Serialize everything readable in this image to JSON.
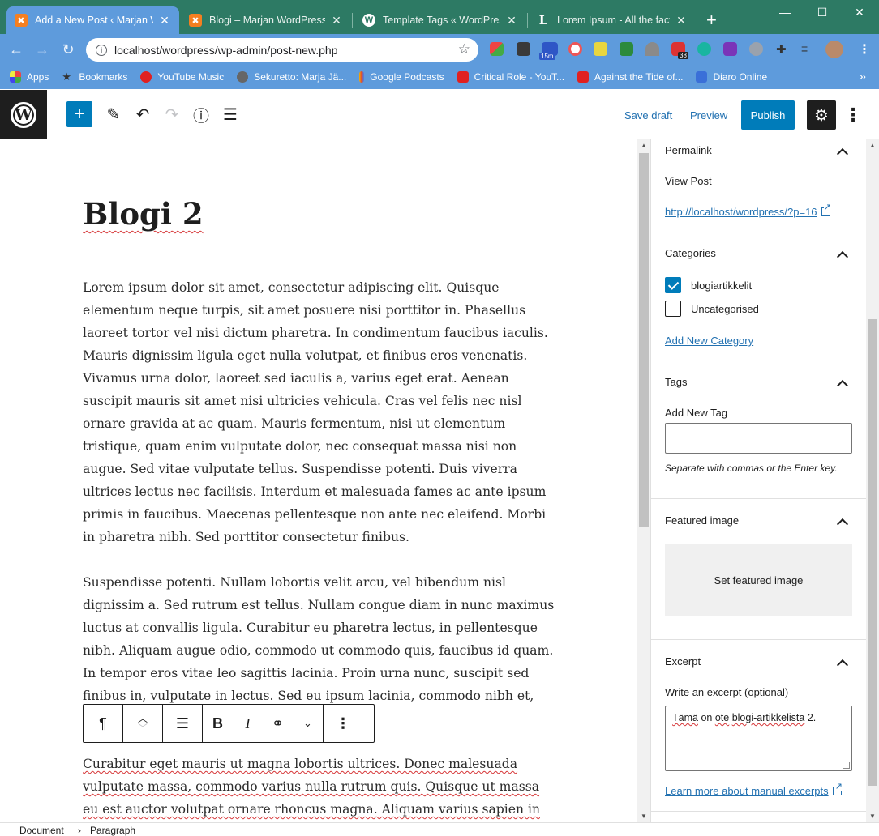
{
  "browser": {
    "tabs": [
      {
        "title": "Add a New Post ‹ Marjan W",
        "active": true,
        "icon": "xampp-icon"
      },
      {
        "title": "Blogi – Marjan WordPress",
        "active": false,
        "icon": "xampp-icon"
      },
      {
        "title": "Template Tags « WordPress",
        "active": false,
        "icon": "wordpress-icon"
      },
      {
        "title": "Lorem Ipsum - All the facts",
        "active": false,
        "icon": "lorem-icon"
      }
    ],
    "url": "localhost/wordpress/wp-admin/post-new.php",
    "extension_badges": {
      "timer": "15m",
      "count": "38"
    },
    "bookmarks": [
      {
        "label": "Apps",
        "color": "#e8c050"
      },
      {
        "label": "Bookmarks",
        "color": "#ffffff"
      },
      {
        "label": "YouTube Music",
        "color": "#e02020"
      },
      {
        "label": "Sekuretto: Marja Jä...",
        "color": "#c0c0c0"
      },
      {
        "label": "Google Podcasts",
        "color": "#f4b400"
      },
      {
        "label": "Critical Role - YouT...",
        "color": "#e02020"
      },
      {
        "label": "Against the Tide of...",
        "color": "#e02020"
      },
      {
        "label": "Diaro Online",
        "color": "#3a6fd8"
      }
    ]
  },
  "wp": {
    "save_draft": "Save draft",
    "preview": "Preview",
    "publish": "Publish"
  },
  "post": {
    "title": "Blogi 2",
    "paragraphs": [
      "Lorem ipsum dolor sit amet, consectetur adipiscing elit. Quisque elementum neque turpis, sit amet posuere nisi porttitor in. Phasellus laoreet tortor vel nisi dictum pharetra. In condimentum faucibus iaculis. Mauris dignissim ligula eget nulla volutpat, et finibus eros venenatis. Vivamus urna dolor, laoreet sed iaculis a, varius eget erat. Aenean suscipit mauris sit amet nisi ultricies vehicula. Cras vel felis nec nisl ornare gravida at ac quam. Mauris fermentum, nisi ut elementum tristique, quam enim vulputate dolor, nec consequat massa nisi non augue. Sed vitae vulputate tellus. Suspendisse potenti. Duis viverra ultrices lectus nec facilisis. Interdum et malesuada fames ac ante ipsum primis in faucibus. Maecenas pellentesque non ante nec eleifend. Morbi in pharetra nibh. Sed porttitor consectetur finibus.",
      "Suspendisse potenti. Nullam lobortis velit arcu, vel bibendum nisl dignissim a. Sed rutrum est tellus. Nullam congue diam in nunc maximus luctus at convallis ligula. Curabitur eu pharetra lectus, in pellentesque nibh. Aliquam augue odio, commodo ut commodo quis, faucibus id quam. In tempor eros vitae leo sagittis lacinia. Proin urna nunc, suscipit sed finibus in, vulputate in lectus. Sed eu ipsum lacinia, commodo nibh et, sollicitudin sapien. Donec",
      "Curabitur eget mauris ut magna lobortis ultrices. Donec malesuada vulputate massa, commodo varius nulla rutrum quis. Quisque ut massa eu est auctor volutpat ornare rhoncus magna. Aliquam varius sapien in"
    ]
  },
  "sidebar": {
    "permalink": {
      "title": "Permalink",
      "view_post": "View Post",
      "url": "http://localhost/wordpress/?p=16"
    },
    "categories": {
      "title": "Categories",
      "items": [
        {
          "label": "blogiartikkelit",
          "checked": true
        },
        {
          "label": "Uncategorised",
          "checked": false
        }
      ],
      "add_new": "Add New Category"
    },
    "tags": {
      "title": "Tags",
      "label": "Add New Tag",
      "value": "",
      "help": "Separate with commas or the Enter key."
    },
    "featured_image": {
      "title": "Featured image",
      "button": "Set featured image"
    },
    "excerpt": {
      "title": "Excerpt",
      "label": "Write an excerpt (optional)",
      "value_words": [
        "Tämä",
        "on",
        "ote",
        "blogi-artikkelista",
        "2."
      ],
      "learn_more": "Learn more about manual excerpts"
    }
  },
  "footer": {
    "breadcrumb": [
      "Document",
      "Paragraph"
    ]
  },
  "colors": {
    "accent": "#007cba",
    "link": "#2271b1",
    "browser_chrome": "#5e9bdc",
    "tabstrip": "#2d7a64"
  }
}
